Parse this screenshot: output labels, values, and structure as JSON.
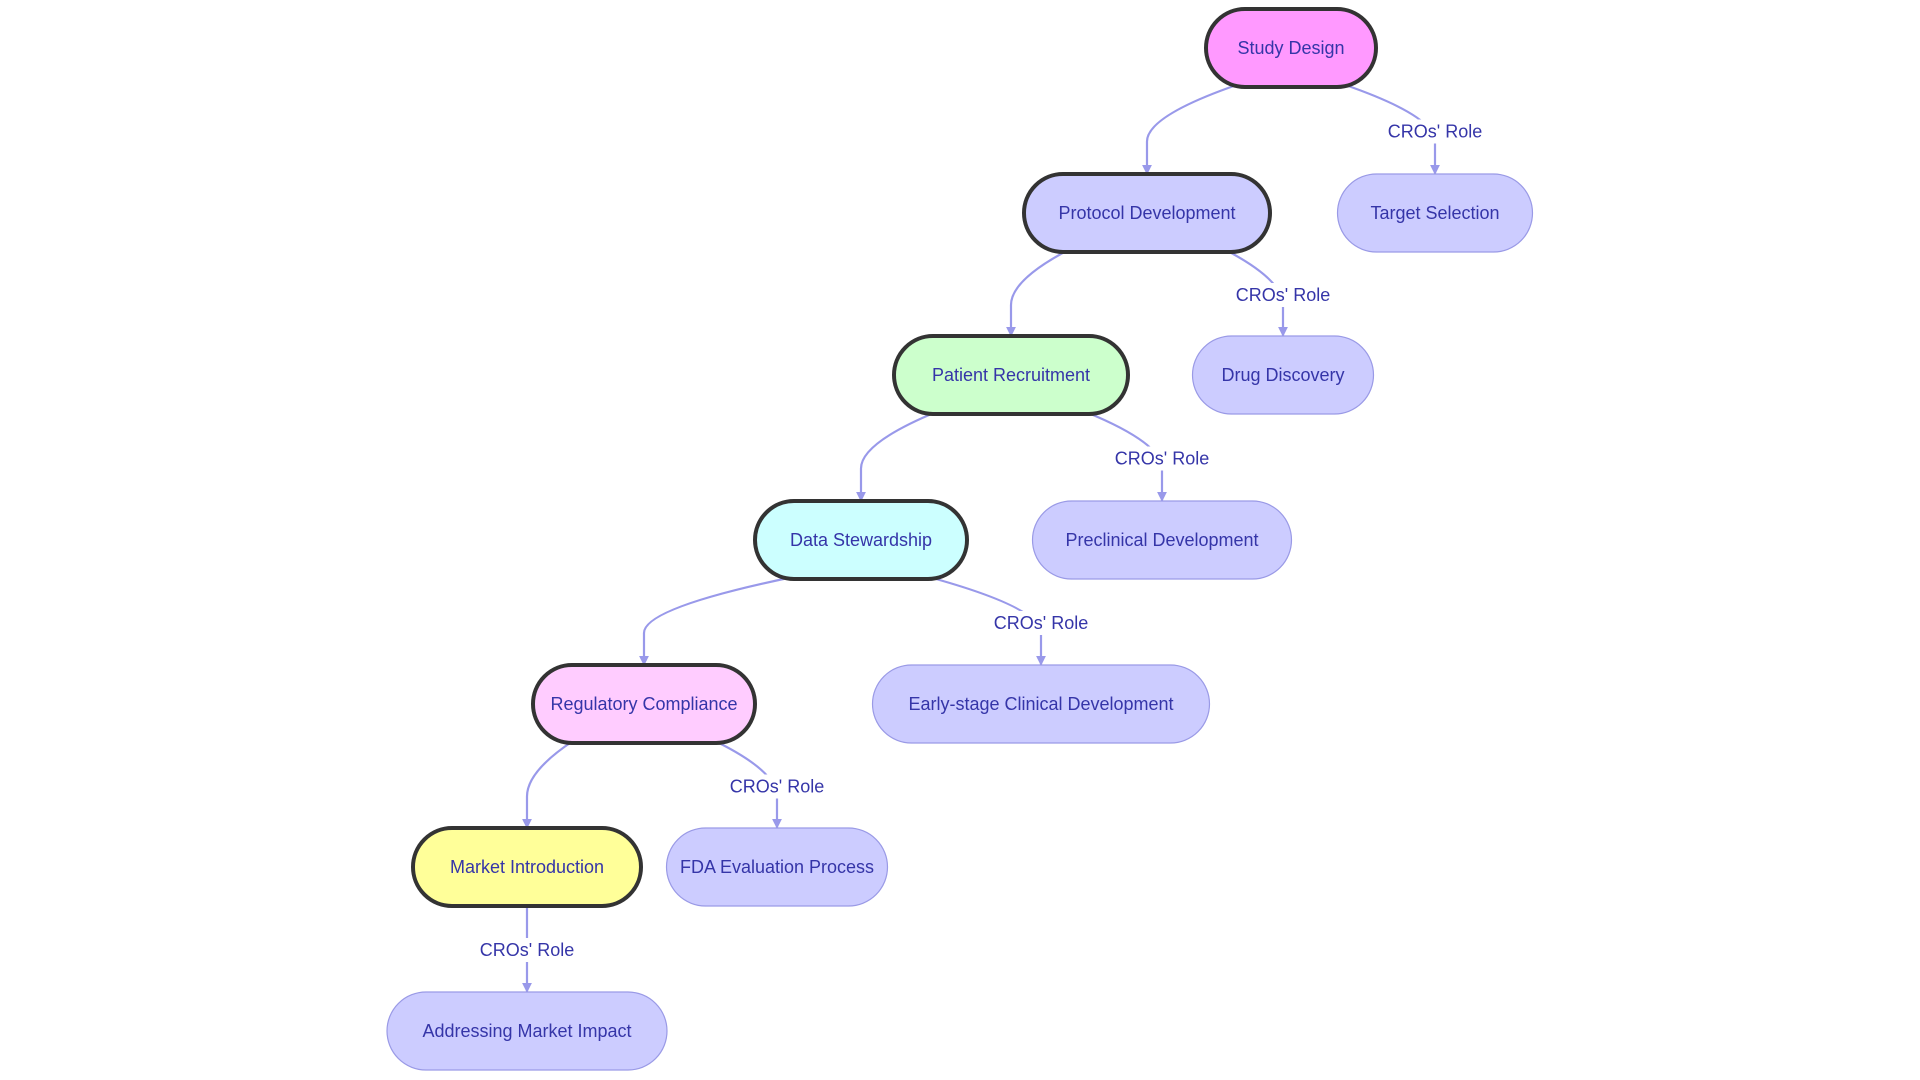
{
  "diagram": {
    "type": "flowchart",
    "stages": [
      {
        "id": "study_design",
        "label": "Study Design",
        "color": "#ff99ff"
      },
      {
        "id": "protocol_development",
        "label": "Protocol Development",
        "color": "#ccccff"
      },
      {
        "id": "patient_recruitment",
        "label": "Patient Recruitment",
        "color": "#ccffcc"
      },
      {
        "id": "data_stewardship",
        "label": "Data Stewardship",
        "color": "#ccffff"
      },
      {
        "id": "regulatory_compliance",
        "label": "Regulatory Compliance",
        "color": "#ffccff"
      },
      {
        "id": "market_introduction",
        "label": "Market Introduction",
        "color": "#ffff99"
      }
    ],
    "cro_roles": [
      {
        "id": "target_selection",
        "label": "Target Selection",
        "color": "#ccccff"
      },
      {
        "id": "drug_discovery",
        "label": "Drug Discovery",
        "color": "#ccccff"
      },
      {
        "id": "preclinical_development",
        "label": "Preclinical Development",
        "color": "#ccccff"
      },
      {
        "id": "early_stage_clinical",
        "label": "Early-stage Clinical Development",
        "color": "#ccccff"
      },
      {
        "id": "fda_evaluation",
        "label": "FDA Evaluation Process",
        "color": "#ccccff"
      },
      {
        "id": "addressing_market_impact",
        "label": "Addressing Market Impact",
        "color": "#ccccff"
      }
    ],
    "edges": [
      {
        "from": "study_design",
        "to": "protocol_development",
        "label": ""
      },
      {
        "from": "study_design",
        "to": "target_selection",
        "label": "CROs' Role"
      },
      {
        "from": "protocol_development",
        "to": "patient_recruitment",
        "label": ""
      },
      {
        "from": "protocol_development",
        "to": "drug_discovery",
        "label": "CROs' Role"
      },
      {
        "from": "patient_recruitment",
        "to": "data_stewardship",
        "label": ""
      },
      {
        "from": "patient_recruitment",
        "to": "preclinical_development",
        "label": "CROs' Role"
      },
      {
        "from": "data_stewardship",
        "to": "regulatory_compliance",
        "label": ""
      },
      {
        "from": "data_stewardship",
        "to": "early_stage_clinical",
        "label": "CROs' Role"
      },
      {
        "from": "regulatory_compliance",
        "to": "market_introduction",
        "label": ""
      },
      {
        "from": "regulatory_compliance",
        "to": "fda_evaluation",
        "label": "CROs' Role"
      },
      {
        "from": "market_introduction",
        "to": "addressing_market_impact",
        "label": "CROs' Role"
      }
    ],
    "colors": {
      "edge": "#9999ea",
      "text": "#3535a8",
      "stage_border": "#333333",
      "cro_border": "#9a9ae6"
    }
  }
}
